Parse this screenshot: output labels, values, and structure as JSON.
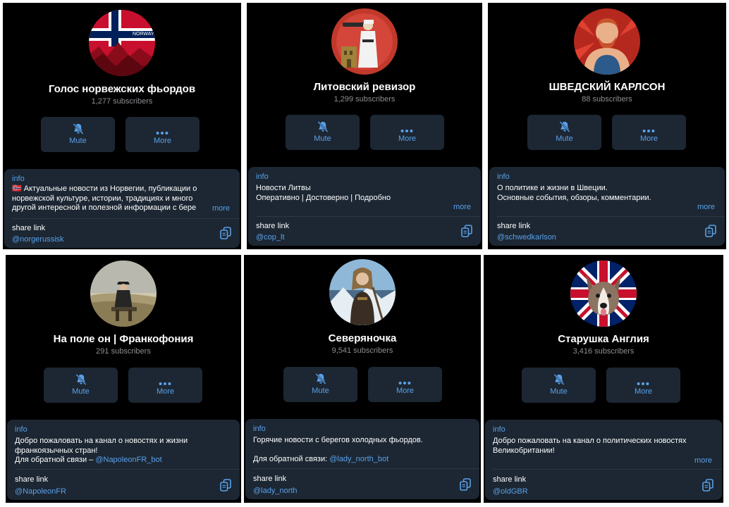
{
  "labels": {
    "mute": "Mute",
    "more_button": "More",
    "info": "info",
    "more_link": "more",
    "share_link": "share link"
  },
  "colors": {
    "card_bg": "#000000",
    "panel_bg": "#1c2733",
    "accent": "#5aa0e8",
    "secondary_text": "#8e8e93"
  },
  "channels": [
    {
      "name": "Голос норвежских фьордов",
      "subscribers": "1,277 subscribers",
      "flag": "🇳🇴",
      "description_lines": [
        "Актуальные новости из Норвегии, публикации о",
        "норвежской культуре, истории, традициях и много",
        "другой интересной и полезной информации с бере"
      ],
      "avatar_text": "NORWAY",
      "handle": "@norgerussisk"
    },
    {
      "name": "Литовский ревизор",
      "subscribers": "1,299 subscribers",
      "description_lines": [
        "Новости Литвы",
        "Оперативно | Достоверно | Подробно"
      ],
      "handle": "@cop_lt"
    },
    {
      "name": "ШВЕДСКИЙ КАРЛСОН",
      "subscribers": "88 subscribers",
      "description_lines": [
        "О политике и жизни в Швеции.",
        "Основные события, обзоры, комментарии."
      ],
      "handle": "@schwedkarlson"
    },
    {
      "name": "На поле он | Франкофония",
      "subscribers": "291 subscribers",
      "description_lines": [
        "Добро пожаловать на канал о новостях и жизни",
        "франкоязычных стран!"
      ],
      "feedback_prefix": "Для обратной связи – ",
      "feedback_link": "@NapoleonFR_bot",
      "handle": "@NapoleonFR"
    },
    {
      "name": "Северяночка",
      "subscribers": "9,541 subscribers",
      "description_lines": [
        "Горячие новости с берегов холодных фьордов."
      ],
      "feedback_prefix": "Для обратной связи: ",
      "feedback_link": "@lady_north_bot",
      "handle": "@lady_north"
    },
    {
      "name": "Старушка Англия",
      "subscribers": "3,416 subscribers",
      "description_lines": [
        "Добро пожаловать на канал о политических новостях",
        "Великобритании!"
      ],
      "handle": "@oldGBR"
    }
  ]
}
